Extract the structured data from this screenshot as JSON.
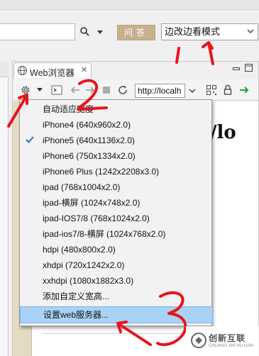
{
  "toolbar": {
    "search_placeholder": "",
    "ask_button": "问答",
    "mode_select_value": "边改边看模式"
  },
  "browser": {
    "tab_label": "Web浏览器",
    "tab_close": "✕",
    "url": "http://localh",
    "page_heading": "/lo"
  },
  "menu": {
    "items": [
      {
        "label": "自动适应宽度",
        "checked": false
      },
      {
        "label": "iPhone4 (640x960x2.0)",
        "checked": false
      },
      {
        "label": "iPhone5 (640x1136x2.0)",
        "checked": true
      },
      {
        "label": "iPhone6 (750x1334x2.0)",
        "checked": false
      },
      {
        "label": "iPhone6 Plus (1242x2208x3.0)",
        "checked": false
      },
      {
        "label": "ipad (768x1004x2.0)",
        "checked": false
      },
      {
        "label": "ipad-横屏 (1024x748x2.0)",
        "checked": false
      },
      {
        "label": "ipad-IOS7/8 (768x1024x2.0)",
        "checked": false
      },
      {
        "label": "ipad-ios7/8-横屏 (1024x768x2.0)",
        "checked": false
      },
      {
        "label": "hdpi (480x800x2.0)",
        "checked": false
      },
      {
        "label": "xhdpi (720x1242x2.0)",
        "checked": false
      },
      {
        "label": "xxhdpi (1080x1882x3.0)",
        "checked": false
      },
      {
        "label": "添加自定义宽高...",
        "checked": false
      },
      {
        "label": "设置web服务器...",
        "checked": false,
        "highlighted": true
      }
    ]
  },
  "annotations": {
    "numbers": [
      "1",
      "2",
      "3"
    ],
    "color": "#e8141c"
  },
  "watermark": {
    "name": "创新互联",
    "subtitle": "CHUANG XIN HU LIAN"
  },
  "colors": {
    "ask_button_bg": "#c6b08f",
    "menu_highlight": "#a9d2f7",
    "check_color": "#2a6fd1",
    "content_olive": "#e3dcc2"
  },
  "icons": [
    "search-icon",
    "chevron-down-icon",
    "globe-icon",
    "close-icon",
    "minimize-icon",
    "maximize-icon",
    "gear-icon",
    "terminal-icon",
    "back-icon",
    "forward-icon",
    "stop-icon",
    "refresh-icon",
    "qr-code-icon",
    "lock-icon",
    "go-arrow-icon",
    "check-icon"
  ]
}
